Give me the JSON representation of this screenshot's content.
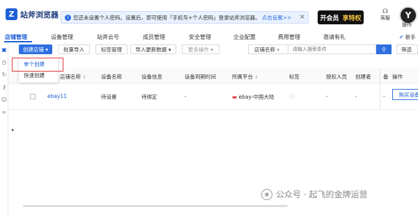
{
  "app": {
    "logo_text": "站斧浏览器",
    "logo_mark": "Z"
  },
  "notice": {
    "text": "您还未设置个人密码。设置后，即可使用「手机号+个人密码」登录站斧浏览器。",
    "link": "点击设置>>",
    "close": "×"
  },
  "promo": {
    "part1": "开会员",
    "part2": "享特权"
  },
  "header": {
    "service_label": "客服",
    "operator_label": "操作",
    "avatar_text": "Y"
  },
  "nav": {
    "items": [
      "店铺管理",
      "设备管理",
      "站斧云号",
      "成员管理",
      "安全管理",
      "企业配置",
      "费用管理",
      "邀请有礼"
    ],
    "right_label": "新手"
  },
  "toolbar": {
    "create_store": "创建店铺",
    "batch_import": "批量导入",
    "tag_manage": "标签管理",
    "import_update": "导入更新数据",
    "more_actions": "更多操作",
    "search_field": "店铺名称",
    "search_placeholder": "请输入搜索条件",
    "filter": "筛选"
  },
  "dropdown": {
    "items": [
      "单个创建",
      "快速创建"
    ]
  },
  "table": {
    "columns": [
      "店铺名称",
      "设备名称",
      "设备信息",
      "设备到期时间",
      "所属平台",
      "标签",
      "授权人员",
      "创建者",
      "备",
      "操作"
    ],
    "rows": [
      {
        "store_name": "ebay11",
        "device_name": "待设置",
        "device_info": "待绑定",
        "expiry": "-",
        "platform": "ebay-中国大陆",
        "authorized": "-",
        "creator": "-",
        "remark": "-",
        "action": "购买设备"
      }
    ]
  },
  "watermark": {
    "text": "公众号 · 起飞的金牌运营"
  }
}
